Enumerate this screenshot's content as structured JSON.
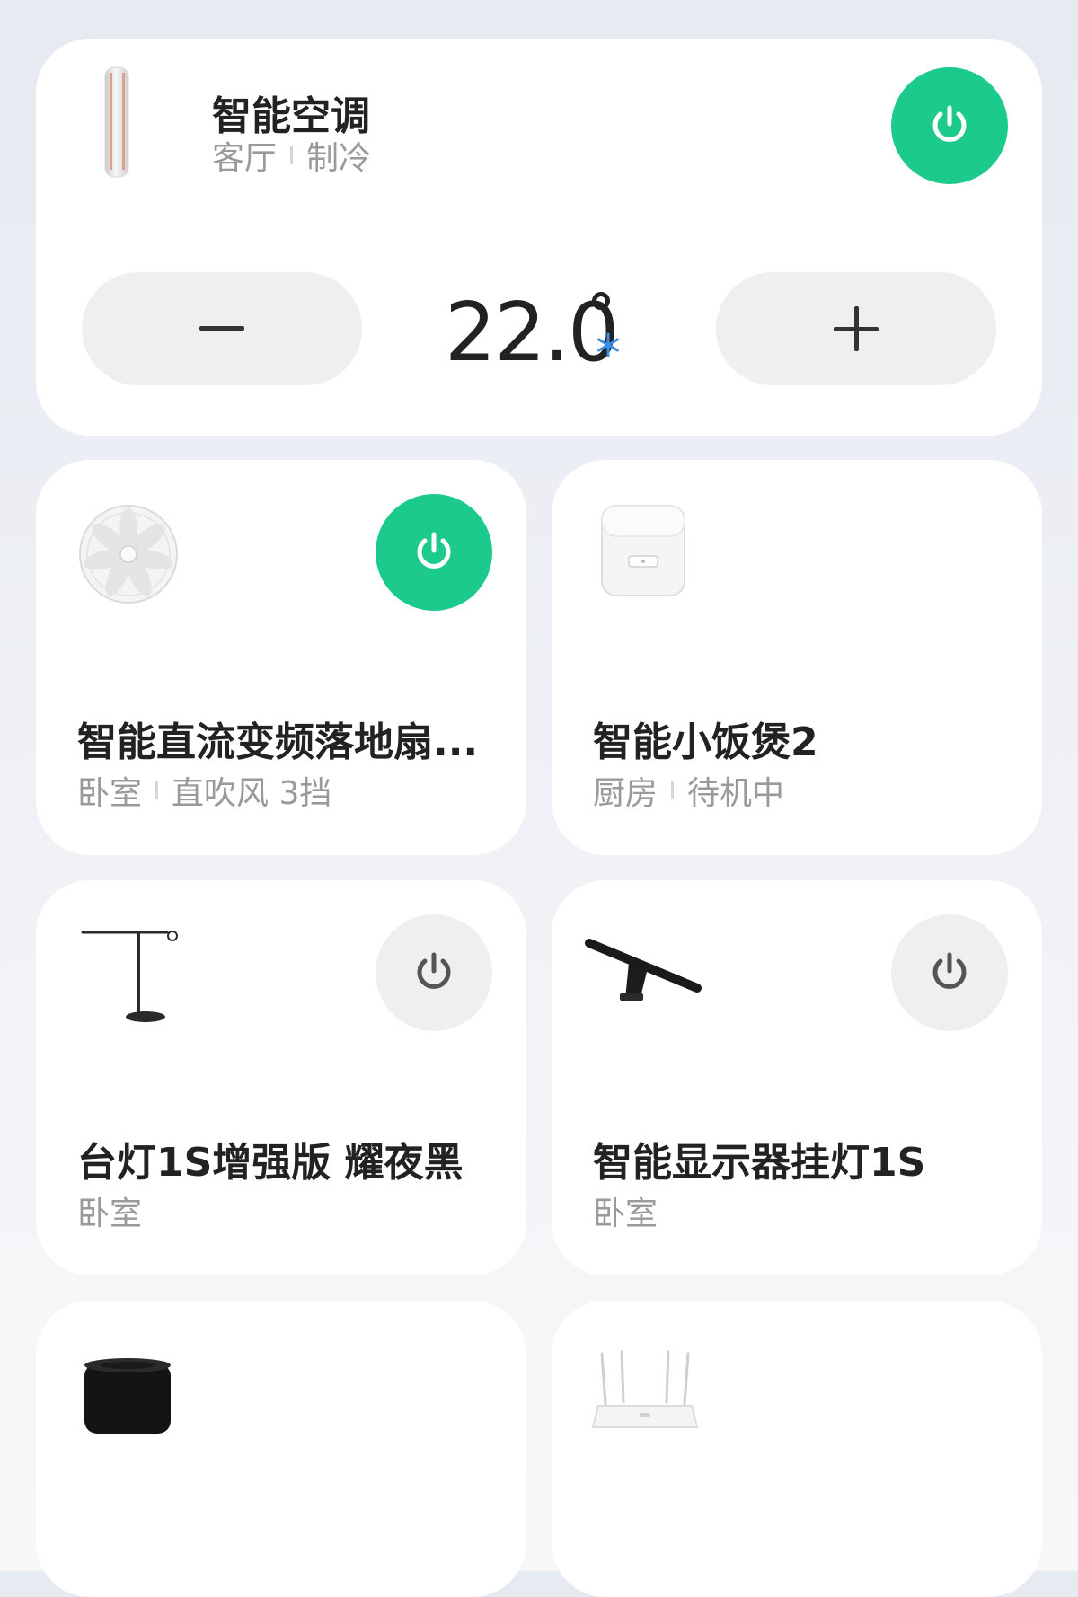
{
  "ac": {
    "name": "智能空调",
    "room": "客厅",
    "mode": "制冷",
    "temperature": "22.0",
    "power_on": true,
    "icon": "air-conditioner-icon"
  },
  "devices": [
    {
      "name": "智能直流变频落地扇...",
      "room": "卧室",
      "status": "直吹风 3挡",
      "power": "on",
      "icon": "fan-icon"
    },
    {
      "name": "智能小饭煲2",
      "room": "厨房",
      "status": "待机中",
      "power": "none",
      "icon": "rice-cooker-icon"
    },
    {
      "name": "台灯1S增强版 耀夜黑",
      "room": "卧室",
      "status": "",
      "power": "off",
      "icon": "desk-lamp-icon"
    },
    {
      "name": "智能显示器挂灯1S",
      "room": "卧室",
      "status": "",
      "power": "off",
      "icon": "monitor-light-icon"
    },
    {
      "name": "",
      "room": "",
      "status": "",
      "power": "none",
      "icon": "smart-speaker-icon"
    },
    {
      "name": "",
      "room": "",
      "status": "",
      "power": "none",
      "icon": "router-icon"
    }
  ],
  "colors": {
    "power_on": "#1ccb8c",
    "power_off": "#efefef",
    "snow": "#3a8ee6"
  }
}
